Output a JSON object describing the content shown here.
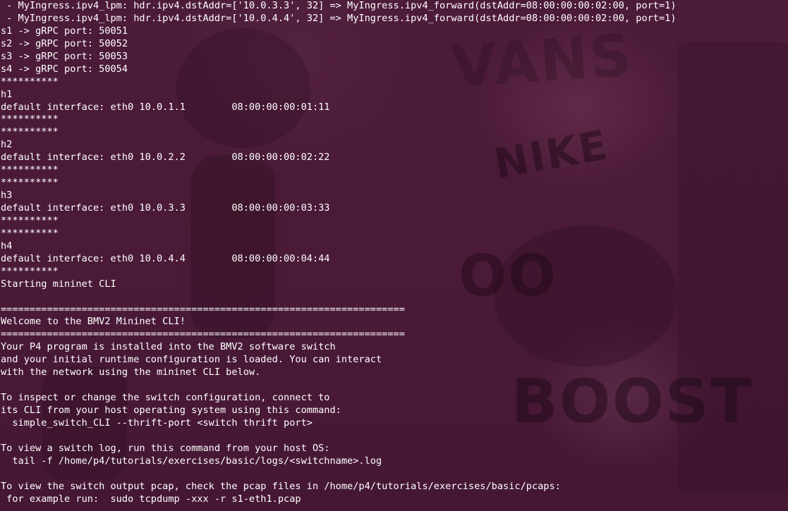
{
  "terminal": {
    "lines": [
      " - MyIngress.ipv4_lpm: hdr.ipv4.dstAddr=['10.0.3.3', 32] => MyIngress.ipv4_forward(dstAddr=08:00:00:00:02:00, port=1)",
      " - MyIngress.ipv4_lpm: hdr.ipv4.dstAddr=['10.0.4.4', 32] => MyIngress.ipv4_forward(dstAddr=08:00:00:00:02:00, port=1)",
      "s1 -> gRPC port: 50051",
      "s2 -> gRPC port: 50052",
      "s3 -> gRPC port: 50053",
      "s4 -> gRPC port: 50054",
      "**********",
      "h1",
      "default interface: eth0 10.0.1.1        08:00:00:00:01:11",
      "**********",
      "**********",
      "h2",
      "default interface: eth0 10.0.2.2        08:00:00:00:02:22",
      "**********",
      "**********",
      "h3",
      "default interface: eth0 10.0.3.3        08:00:00:00:03:33",
      "**********",
      "**********",
      "h4",
      "default interface: eth0 10.0.4.4        08:00:00:00:04:44",
      "**********",
      "Starting mininet CLI",
      "",
      "======================================================================",
      "Welcome to the BMV2 Mininet CLI!",
      "======================================================================",
      "Your P4 program is installed into the BMV2 software switch",
      "and your initial runtime configuration is loaded. You can interact",
      "with the network using the mininet CLI below.",
      "",
      "To inspect or change the switch configuration, connect to",
      "its CLI from your host operating system using this command:",
      "  simple_switch_CLI --thrift-port <switch thrift port>",
      "",
      "To view a switch log, run this command from your host OS:",
      "  tail -f /home/p4/tutorials/exercises/basic/logs/<switchname>.log",
      "",
      "To view the switch output pcap, check the pcap files in /home/p4/tutorials/exercises/basic/pcaps:",
      " for example run:  sudo tcpdump -xxx -r s1-eth1.pcap"
    ]
  },
  "wallpaper": {
    "texts": [
      "VANS",
      "NIKE",
      "BOOST",
      "OO"
    ]
  }
}
